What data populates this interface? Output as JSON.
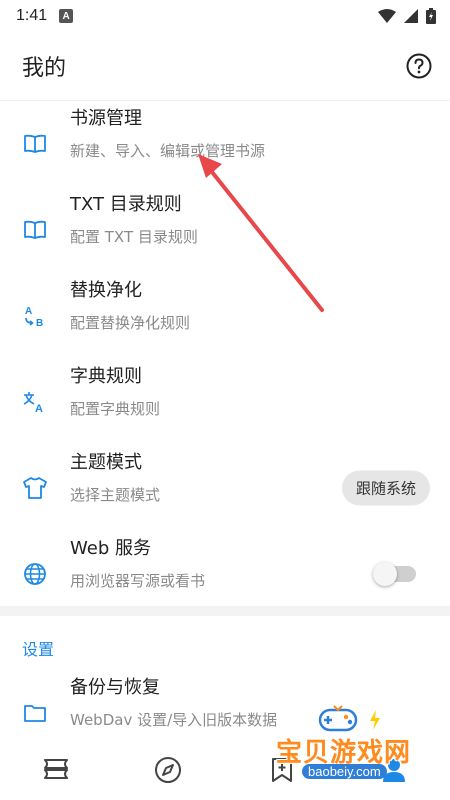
{
  "status_bar": {
    "time": "1:41",
    "notification_badge": "A"
  },
  "app_bar": {
    "title": "我的",
    "help_icon": "help-circle-icon"
  },
  "menu_items": [
    {
      "title": "书源管理",
      "subtitle": "新建、导入、编辑或管理书源",
      "icon": "book-open-icon"
    },
    {
      "title": "TXT 目录规则",
      "subtitle": "配置 TXT 目录规则",
      "icon": "book-open-icon"
    },
    {
      "title": "替换净化",
      "subtitle": "配置替换净化规则",
      "icon": "replace-ab-icon"
    },
    {
      "title": "字典规则",
      "subtitle": "配置字典规则",
      "icon": "translate-icon"
    },
    {
      "title": "主题模式",
      "subtitle": "选择主题模式",
      "icon": "shirt-icon",
      "value": "跟随系统"
    },
    {
      "title": "Web 服务",
      "subtitle": "用浏览器写源或看书",
      "icon": "globe-icon",
      "toggle_on": false
    }
  ],
  "settings_section": {
    "header": "设置",
    "items": [
      {
        "title": "备份与恢复",
        "subtitle": "WebDav 设置/导入旧版本数据",
        "icon": "folder-icon"
      }
    ]
  },
  "bottom_nav": [
    {
      "name": "bookshelf",
      "icon": "bookshelf-icon"
    },
    {
      "name": "explore",
      "icon": "compass-icon"
    },
    {
      "name": "rss",
      "icon": "bookmark-icon"
    },
    {
      "name": "mine",
      "icon": "person-icon"
    }
  ],
  "watermark": {
    "title": "宝贝游戏网",
    "url": "baobeiy.com"
  },
  "colors": {
    "accent": "#1e88e5",
    "annotation_arrow": "#e8474b",
    "chip_bg": "#e6e6e6"
  }
}
